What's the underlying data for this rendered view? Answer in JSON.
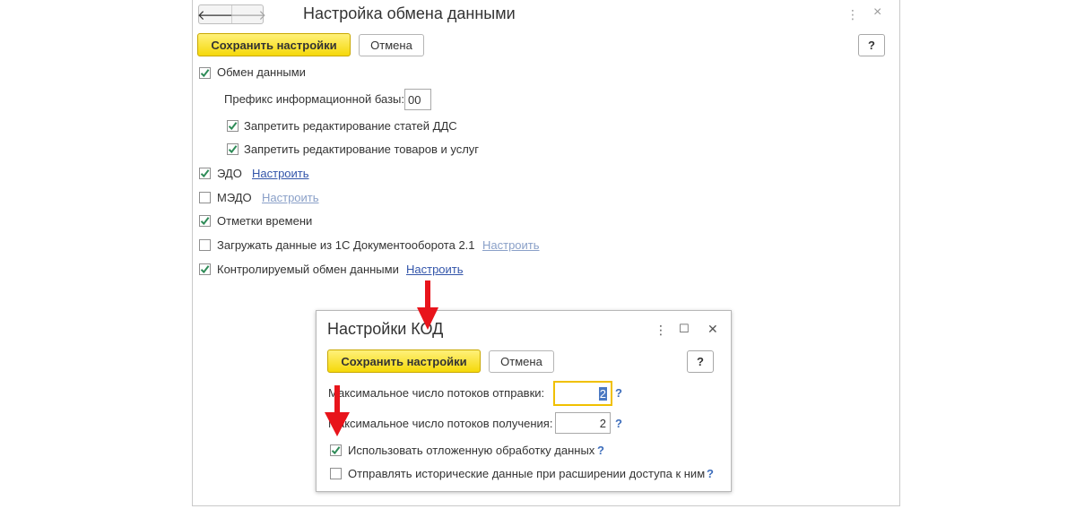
{
  "main": {
    "title": "Настройка обмена данными",
    "nav": {
      "back_icon": "arrow-left-icon",
      "forward_icon": "arrow-right-icon",
      "back_glyph": "🡐",
      "forward_glyph": "🡒"
    },
    "header_icons": {
      "more_glyph": "⋮",
      "close_glyph": "×"
    },
    "save_label": "Сохранить настройки",
    "cancel_label": "Отмена",
    "help_label": "?",
    "exchange": {
      "label": "Обмен данными",
      "checked": true
    },
    "prefix": {
      "label": "Префикс информационной базы:",
      "value": "00"
    },
    "sub_options": [
      {
        "label": "Запретить редактирование статей ДДС",
        "checked": true
      },
      {
        "label": "Запретить редактирование товаров и услуг",
        "checked": true
      }
    ],
    "options": [
      {
        "label": "ЭДО",
        "checked": true,
        "link": "Настроить",
        "link_enabled": true
      },
      {
        "label": "МЭДО",
        "checked": false,
        "link": "Настроить",
        "link_enabled": false
      },
      {
        "label": "Отметки времени",
        "checked": true,
        "link": "",
        "link_enabled": false
      },
      {
        "label": "Загружать данные из 1С Документооборота 2.1",
        "checked": false,
        "link": "Настроить",
        "link_enabled": false
      },
      {
        "label": "Контролируемый обмен данными",
        "checked": true,
        "link": "Настроить",
        "link_enabled": true
      }
    ]
  },
  "dialog": {
    "title": "Настройки КОД",
    "header_icons": {
      "more_glyph": "⋮",
      "maximize_glyph": "☐",
      "close_glyph": "✕"
    },
    "save_label": "Сохранить настройки",
    "cancel_label": "Отмена",
    "help_label": "?",
    "send_threads": {
      "label": "Максимальное число потоков отправки:",
      "value": "2",
      "help": "?"
    },
    "receive_threads": {
      "label": "Максимальное число потоков получения:",
      "value": "2",
      "help": "?"
    },
    "deferred": {
      "label": "Использовать отложенную обработку данных",
      "checked": true,
      "help": "?"
    },
    "historical": {
      "label": "Отправлять исторические данные при расширении доступа к ним",
      "checked": false,
      "help": "?"
    }
  },
  "colors": {
    "accent_yellow": "#f5d90a",
    "check_green": "#2e8b57",
    "link_blue": "#3355aa",
    "arrow_red": "#e8141b"
  }
}
